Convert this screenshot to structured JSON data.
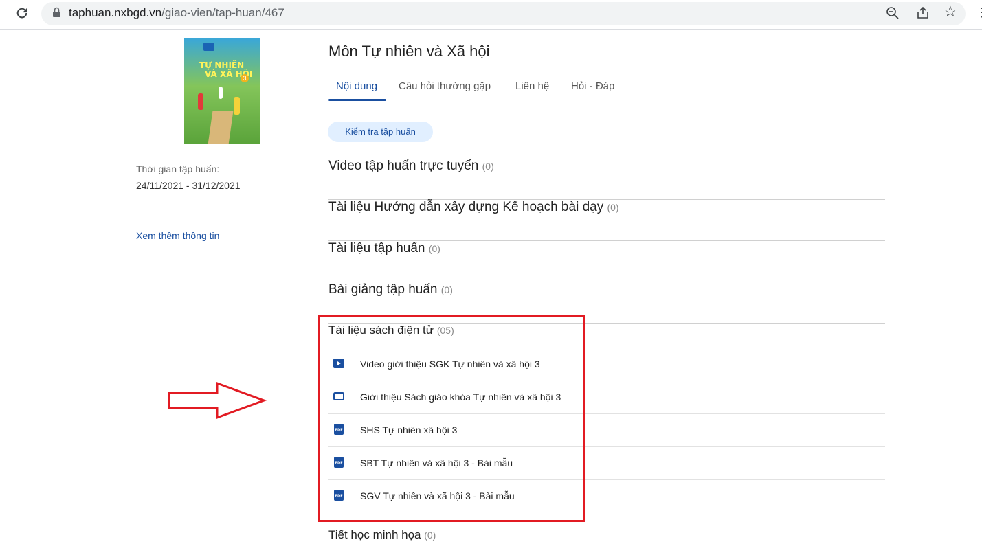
{
  "browser": {
    "domain": "taphuan.nxbgd.vn",
    "path": "/giao-vien/tap-huan/467"
  },
  "cover": {
    "line1": "TỰ NHIÊN",
    "line2": "VÀ XÃ HỘI",
    "grade": "3"
  },
  "sidebar": {
    "time_label": "Thời gian tập huấn:",
    "time_value": "24/11/2021 - 31/12/2021",
    "more_link": "Xem thêm thông tin"
  },
  "main": {
    "title": "Môn Tự nhiên và Xã hội",
    "tabs": [
      {
        "label": "Nội dung"
      },
      {
        "label": "Câu hỏi thường gặp"
      },
      {
        "label": "Liên hệ"
      },
      {
        "label": "Hỏi - Đáp"
      }
    ],
    "check_button": "Kiểm tra tập huấn",
    "sections": [
      {
        "title": "Video tập huấn trực tuyến",
        "count": "(0)"
      },
      {
        "title": "Tài liệu Hướng dẫn xây dựng Kế hoạch bài dạy",
        "count": "(0)"
      },
      {
        "title": "Tài liệu tập huấn",
        "count": "(0)"
      },
      {
        "title": "Bài giảng tập huấn",
        "count": "(0)"
      },
      {
        "title": "Tài liệu sách điện tử",
        "count": "(05)"
      },
      {
        "title": "Tiết học minh họa",
        "count": "(0)"
      }
    ],
    "ebook_items": [
      {
        "icon": "play-icon",
        "label": "Video giới thiệu SGK Tự nhiên và xã hội 3"
      },
      {
        "icon": "slides-icon",
        "label": "Giới thiệu Sách giáo khóa Tự nhiên và xã hội 3"
      },
      {
        "icon": "pdf-icon",
        "label": "SHS Tự nhiên xã hội 3"
      },
      {
        "icon": "pdf-icon",
        "label": "SBT Tự nhiên và xã hội 3 - Bài mẫu"
      },
      {
        "icon": "pdf-icon",
        "label": "SGV Tự nhiên và xã hội 3 - Bài mẫu"
      }
    ],
    "pdf_badge": "PDF"
  },
  "colors": {
    "accent": "#1a4fa0",
    "highlight": "#e21b23",
    "chip_bg": "#e1efff"
  }
}
